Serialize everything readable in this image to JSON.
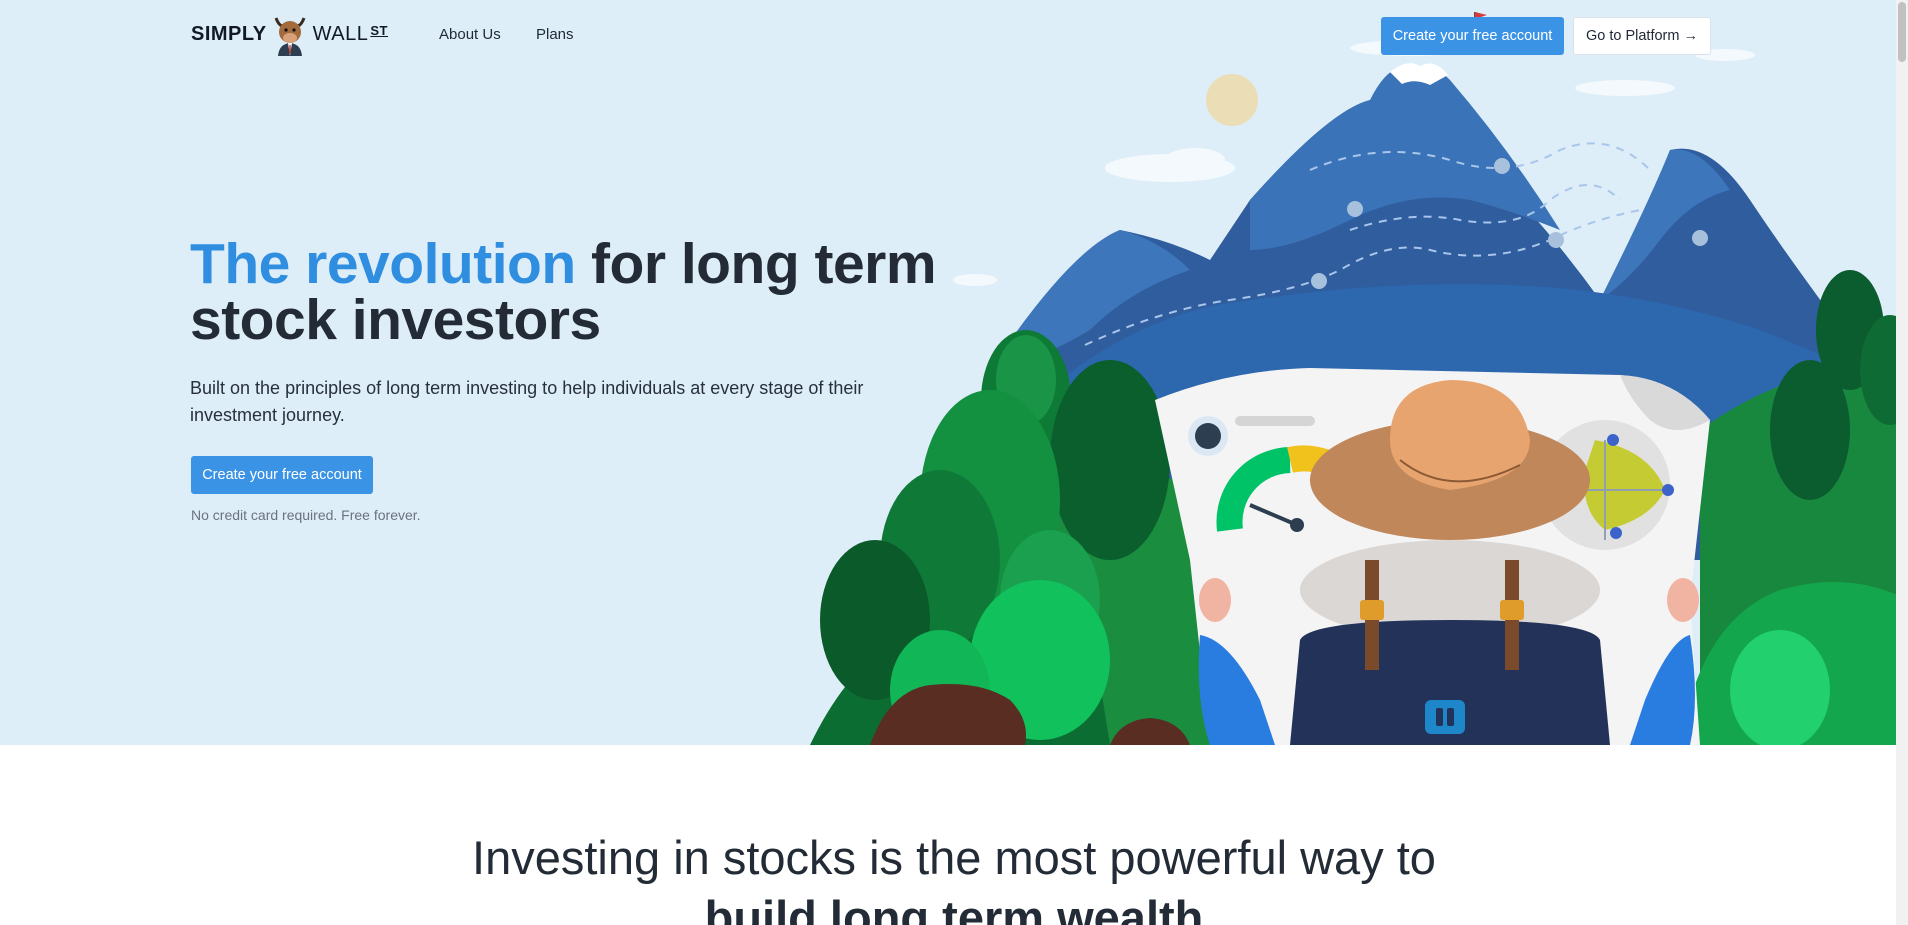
{
  "brand": {
    "logo_left": "SIMPLY",
    "logo_right": "WALL",
    "logo_sup": "ST",
    "mascot_icon": "bull-mascot-icon"
  },
  "nav": {
    "about": "About Us",
    "plans": "Plans",
    "cta_primary": "Create your free account",
    "cta_secondary": "Go to Platform →"
  },
  "hero": {
    "title_accent": "The revolution",
    "title_rest": " for long term stock investors",
    "subtitle": "Built on the principles of long term investing to help individuals at every stage of their investment journey.",
    "cta": "Create your free account",
    "fineprint": "No credit card required. Free forever."
  },
  "section": {
    "heading_line1": "Investing in stocks is the most powerful way to",
    "heading_line2": "build long term wealth"
  },
  "colors": {
    "hero_bg": "#deeef8",
    "accent_blue": "#3b93e6",
    "title_accent": "#2f8ee0",
    "text_dark": "#222b36"
  }
}
